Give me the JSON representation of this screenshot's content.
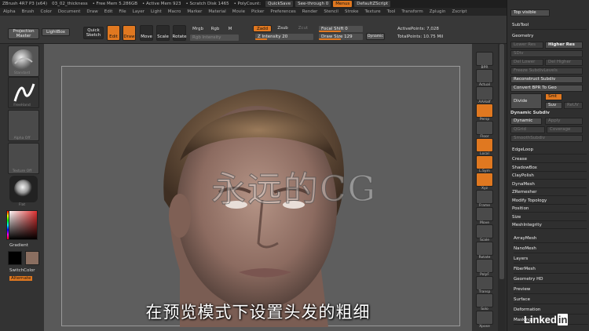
{
  "titlebar": {
    "app": "ZBrush 4R7 P3 (x64)",
    "document": "03_02_thickness",
    "free_mem": "• Free Mem 5.286GB",
    "active_mem": "• Active Mem 923",
    "scratch": "• Scratch Disk 1465",
    "polycount": "• PolyCount:",
    "quicksave": "QuickSave",
    "see_through": "See-through 0",
    "menus": "Menus",
    "script": "DefaultZScript"
  },
  "menubar": [
    "Alpha",
    "Brush",
    "Color",
    "Document",
    "Draw",
    "Edit",
    "File",
    "Layer",
    "Light",
    "Macro",
    "Marker",
    "Material",
    "Movie",
    "Picker",
    "Preferences",
    "Render",
    "Stencil",
    "Stroke",
    "Texture",
    "Tool",
    "Transform",
    "Zplugin",
    "Zscript"
  ],
  "toolbar": {
    "projection_master": "Projection Master",
    "lightbox": "LightBox",
    "quick_sketch": "Quick Sketch",
    "edit": "Edit",
    "draw": "Draw",
    "move": "Move",
    "scale": "Scale",
    "rotate": "Rotate",
    "mrgb": "Mrgb",
    "rgb": "Rgb",
    "m": "M",
    "zadd": "Zadd",
    "zsub": "Zsub",
    "zcut": "Zcut",
    "rgb_intensity": "Rgb Intensity",
    "z_intensity": "Z Intensity 20",
    "focal_shift": "Focal Shift 0",
    "draw_size": "Draw Size 129",
    "dynamic": "Dynamic",
    "active_points": "ActivePoints: 7,028",
    "total_points": "TotalPoints: 10.75 Mil"
  },
  "leftshelf": {
    "brush_label": "Standard",
    "stroke_label": "FreeHand",
    "alpha_label": "Alpha Off",
    "texture_label": "Texture Off",
    "material_label": "Flat",
    "gradient": "Gradient",
    "switch_color": "SwitchColor",
    "alternate": "Alternate"
  },
  "viewport": {
    "watermark": "永远的CG",
    "subtitle": "在预览模式下设置头发的粗细"
  },
  "rightshelf": [
    "BPR",
    "Actual",
    "AAHalf",
    "Persp",
    "Floor",
    "Local",
    "L.Sym",
    "Xyz",
    "Frame",
    "Move",
    "Scale",
    "Rotate",
    "PolyF",
    "Transp",
    "Solo",
    "Xpose"
  ],
  "panel": {
    "top_label": "Top visible",
    "subtool": "SubTool",
    "geometry": "Geometry",
    "lower_res": "Lower Res",
    "higher_res": "Higher Res",
    "sdiv": "SDiv",
    "del_lower": "Del Lower",
    "del_higher": "Del Higher",
    "freeze": "Freeze SubdivLevels",
    "reconstruct": "Reconstruct Subdiv",
    "convert_bpr": "Convert BPR To Geo",
    "divide": "Divide",
    "smt": "Smt",
    "suv": "Suv",
    "rsmt": "ReUV",
    "dynamic_subdiv": "Dynamic Subdiv",
    "dynamic": "Dynamic",
    "apply": "Apply",
    "qgrid": "QGrid",
    "coverage": "Coverage",
    "smooth_subdiv": "SmoothSubdiv",
    "edgeloop": "EdgeLoop",
    "items": [
      "Crease",
      "ShadowBox",
      "ClayPolish",
      "DynaMesh",
      "ZRemesher",
      "Modify Topology",
      "Position",
      "Size",
      "MeshIntegrity"
    ],
    "sections": [
      "ArrayMesh",
      "NanoMesh",
      "Layers",
      "FiberMesh",
      "Geometry HD",
      "Preview",
      "Surface",
      "Deformation",
      "Masking"
    ],
    "brand": "Linked"
  }
}
